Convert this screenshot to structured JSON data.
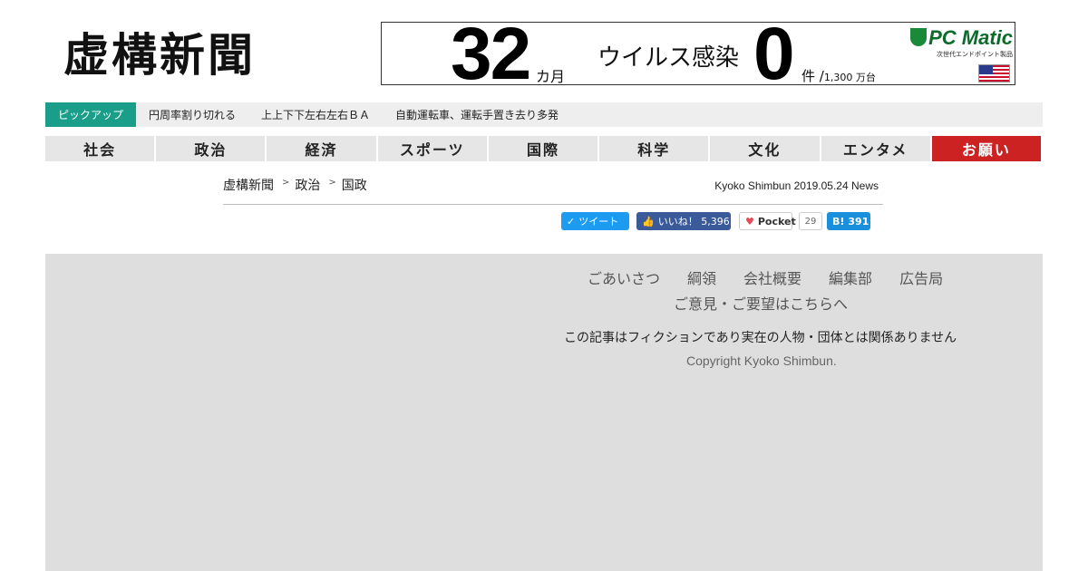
{
  "site": {
    "logo_text": "虚構新聞"
  },
  "ad": {
    "number1": "32",
    "unit1": "カ月",
    "middle_text": "ウイルス感染",
    "number2": "0",
    "unit2": "件 /",
    "unit2_small": "1,300 万台",
    "brand_name": "PC Matic",
    "brand_sub": "次世代エンドポイント製品",
    "icons": [
      "shield-icon",
      "us-flag-icon"
    ]
  },
  "pickup": {
    "label": "ピックアップ",
    "items": [
      "円周率割り切れる",
      "上上下下左右左右ＢＡ",
      "自動運転車、運転手置き去り多発"
    ]
  },
  "nav": {
    "categories": [
      "社会",
      "政治",
      "経済",
      "スポーツ",
      "国際",
      "科学",
      "文化",
      "エンタメ",
      "お願い"
    ],
    "highlight_color": "#cc2222"
  },
  "breadcrumb": [
    "虚構新聞",
    "政治",
    "国政"
  ],
  "byline": "Kyoko Shimbun 2019.05.24 News",
  "social": {
    "tweet_label": "ツイート",
    "like_label": "いいね！",
    "like_count": "5,396",
    "pocket_label": "Pocket",
    "pocket_count": "29",
    "hatena_label": "B!",
    "hatena_count": "391"
  },
  "footer": {
    "links": [
      "ごあいさつ",
      "綱領",
      "会社概要",
      "編集部",
      "広告局"
    ],
    "feedback_link": "ご意見・ご要望はこちらへ",
    "disclaimer": "この記事はフィクションであり実在の人物・団体とは関係ありません",
    "copyright": "Copyright Kyoko Shimbun."
  },
  "colors": {
    "pickup_label": "#1a9e8a",
    "twitter": "#1d9bf0",
    "facebook": "#3b5a9a",
    "hatena": "#1a8fdc"
  }
}
